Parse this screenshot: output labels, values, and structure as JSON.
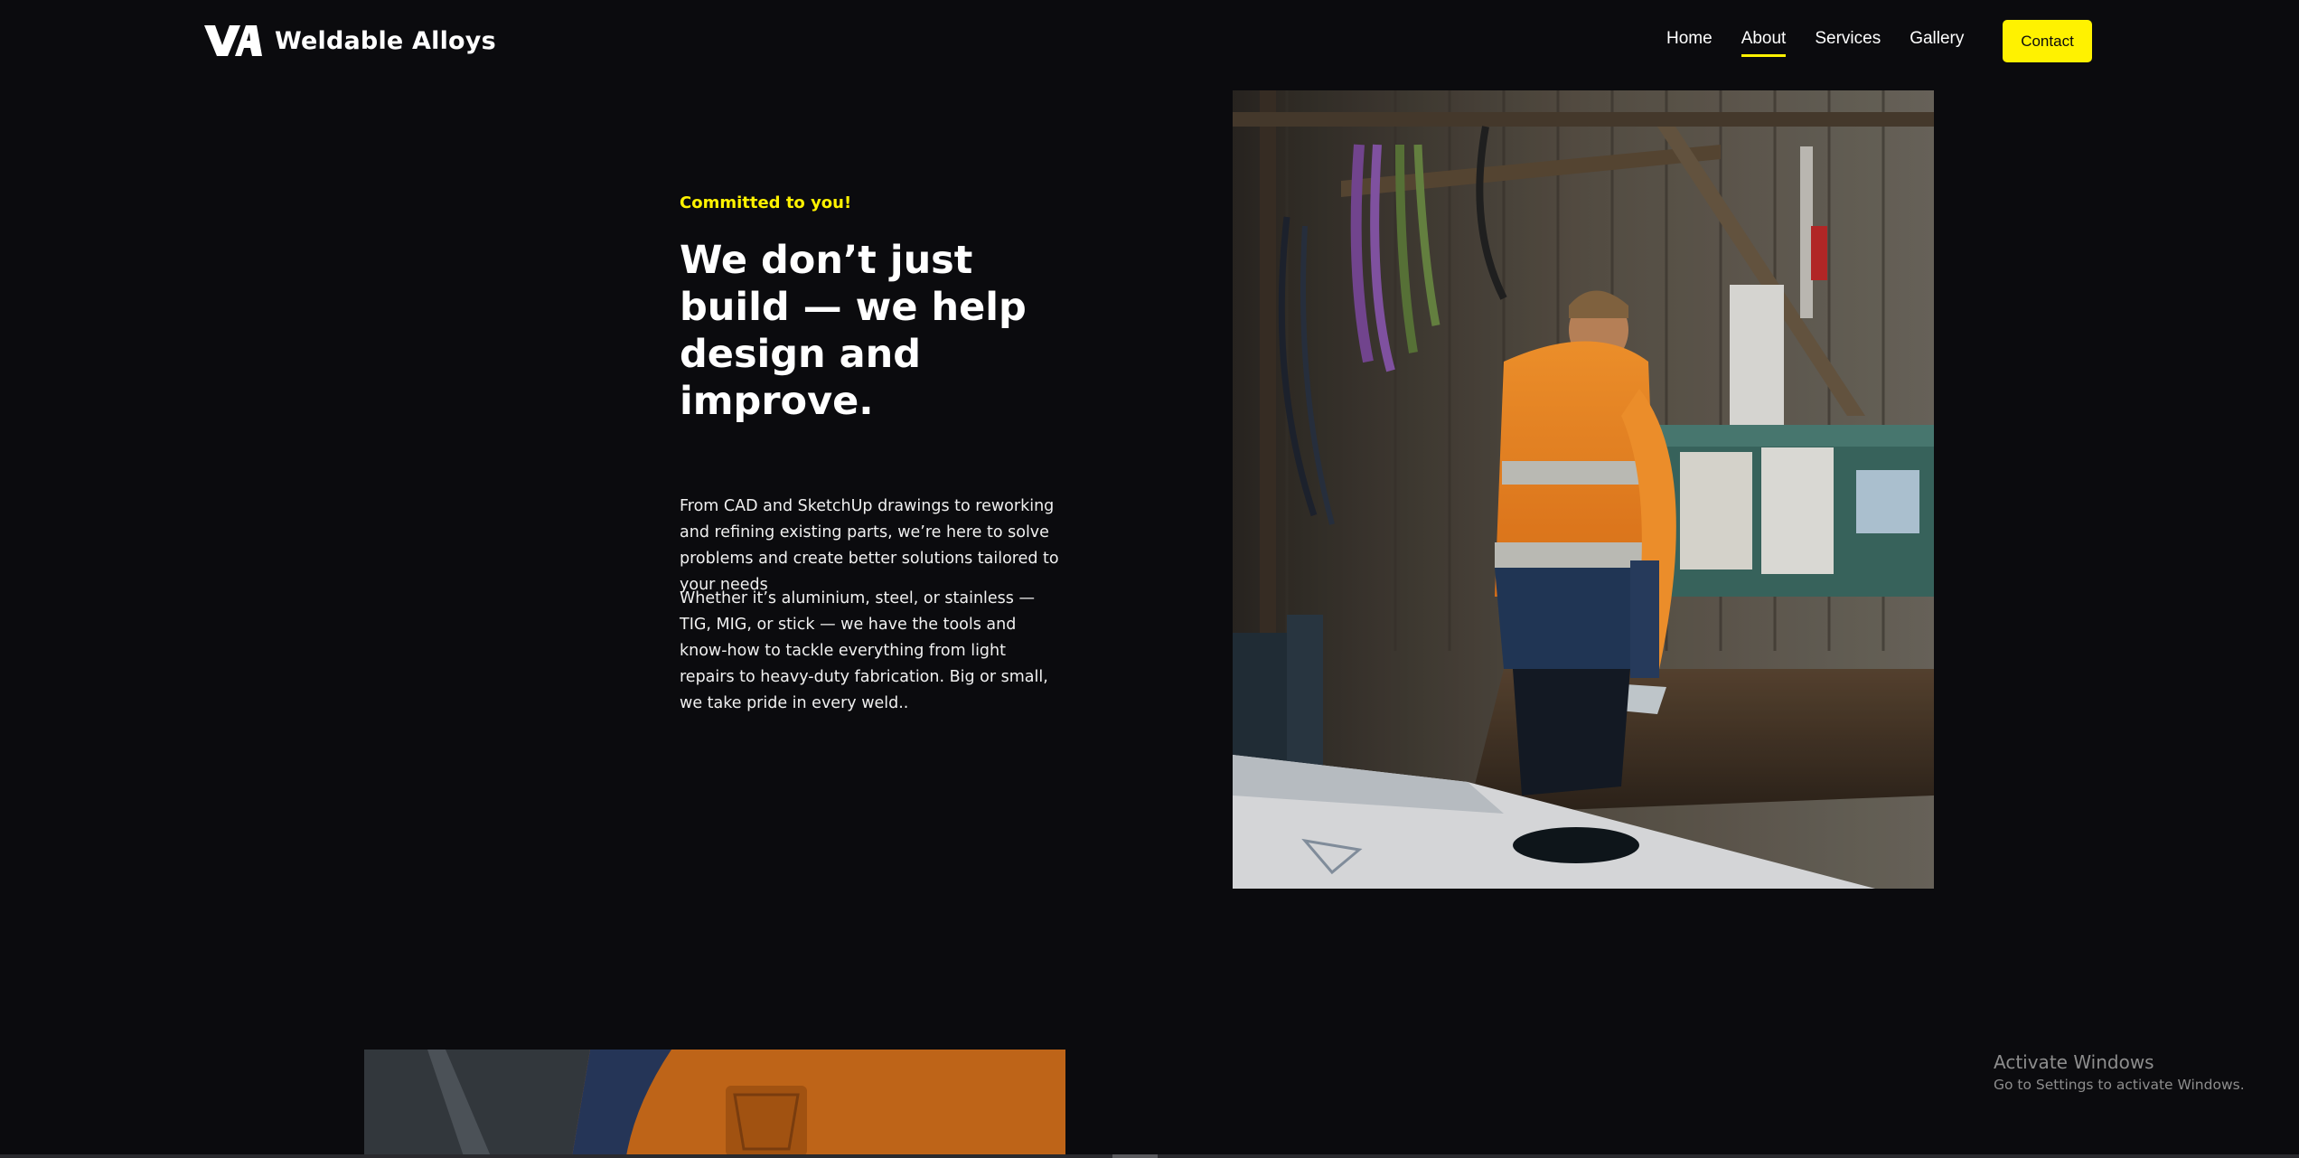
{
  "brand": {
    "name": "Weldable Alloys",
    "logo_icon": "va-monogram-icon",
    "accent_color": "#fff200",
    "background_color": "#0b0b0e"
  },
  "nav": {
    "items": [
      {
        "label": "Home",
        "active": false
      },
      {
        "label": "About",
        "active": true
      },
      {
        "label": "Services",
        "active": false
      },
      {
        "label": "Gallery",
        "active": false
      }
    ],
    "contact_label": "Contact"
  },
  "hero": {
    "eyebrow": "Committed to you!",
    "headline": "We don’t just build — we help design and improve.",
    "paragraph_1": "From CAD and SketchUp drawings to reworking and refining existing parts, we’re here to solve problems and create better solutions tailored to your needs",
    "paragraph_2": "Whether it’s aluminium, steel, or stainless — TIG, MIG, or stick — we have the tools and know-how to tackle everything from light repairs to heavy-duty fabrication. Big or small, we take pride in every weld.."
  },
  "windows_watermark": {
    "title": "Activate Windows",
    "subtitle": "Go to Settings to activate Windows."
  }
}
